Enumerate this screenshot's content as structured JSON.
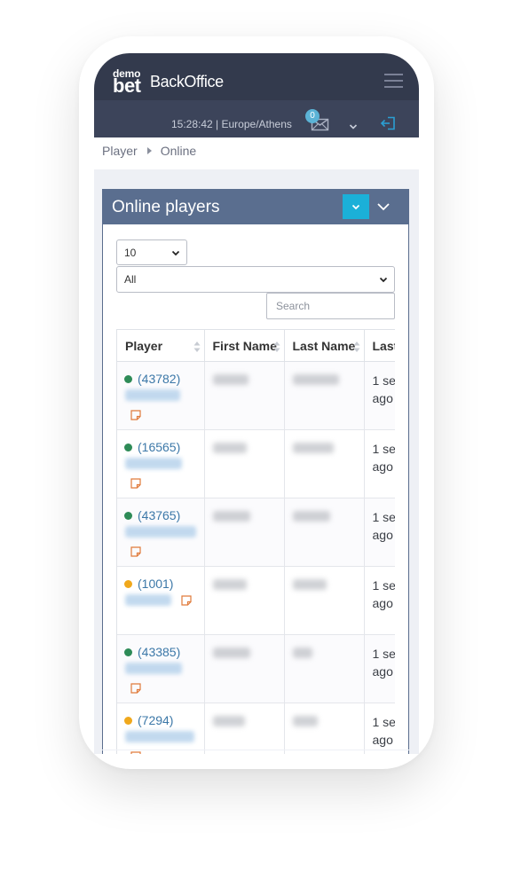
{
  "header": {
    "logo_top": "demo",
    "logo_bottom": "bet",
    "app_name": "BackOffice"
  },
  "subbar": {
    "clock": "15:28:42 | Europe/Athens",
    "message_count": "0"
  },
  "breadcrumb": [
    "Player",
    "Online"
  ],
  "card": {
    "title": "Online players",
    "page_length": "10",
    "filter_value": "All",
    "search_placeholder": "Search"
  },
  "table": {
    "columns": [
      "Player",
      "First Name",
      "Last Name",
      "Last"
    ],
    "rows": [
      {
        "status_color": "#2e8b57",
        "player_id": "(43782)",
        "last_1": "1 se",
        "last_2": "ago",
        "note_inline": false
      },
      {
        "status_color": "#2e8b57",
        "player_id": "(16565)",
        "last_1": "1 se",
        "last_2": "ago",
        "note_inline": false
      },
      {
        "status_color": "#2e8b57",
        "player_id": "(43765)",
        "last_1": "1 se",
        "last_2": "ago",
        "note_inline": false
      },
      {
        "status_color": "#f0a81c",
        "player_id": "(1001)",
        "last_1": "1 se",
        "last_2": "ago",
        "note_inline": true
      },
      {
        "status_color": "#2e8b57",
        "player_id": "(43385)",
        "last_1": "1 se",
        "last_2": "ago",
        "note_inline": false
      },
      {
        "status_color": "#f0a81c",
        "player_id": "(7294)",
        "last_1": "1 se",
        "last_2": "ago",
        "note_inline": false
      }
    ]
  },
  "icons": {
    "menu": "hamburger-icon",
    "messages": "envelope-icon",
    "user_menu": "chevron-down-icon",
    "logout": "logout-icon",
    "note": "note-icon"
  },
  "colors": {
    "topbar": "#333a4d",
    "subbar": "#3c445a",
    "card_header": "#5a6e8f",
    "accent": "#1bb0d8",
    "link": "#3c78a8",
    "online": "#2e8b57",
    "idle": "#f0a81c",
    "note": "#e07a3a"
  }
}
